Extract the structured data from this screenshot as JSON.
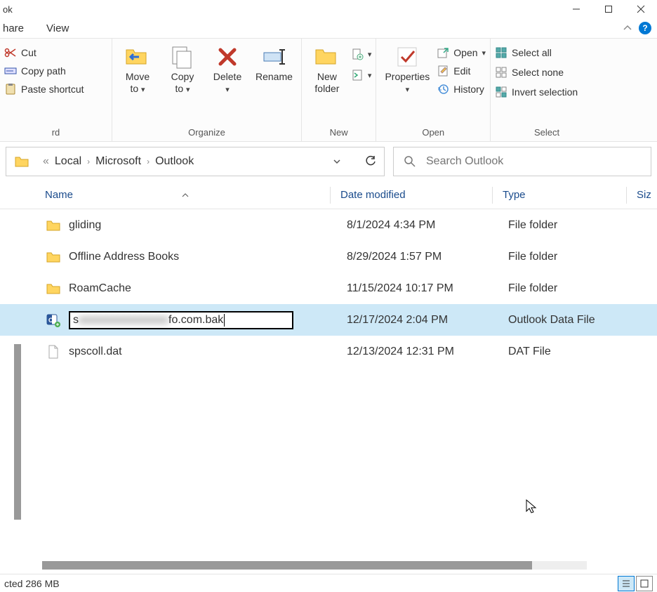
{
  "title_suffix": "ok",
  "tabs": {
    "share": "hare",
    "view": "View"
  },
  "clipboard": {
    "cut": "Cut",
    "copy_path": "Copy path",
    "paste_shortcut": "Paste shortcut",
    "group": "rd"
  },
  "organize": {
    "move_to": "Move\nto",
    "copy_to": "Copy\nto",
    "delete": "Delete",
    "rename": "Rename",
    "group": "Organize"
  },
  "new": {
    "new_folder": "New\nfolder",
    "group": "New"
  },
  "open": {
    "properties": "Properties",
    "open": "Open",
    "edit": "Edit",
    "history": "History",
    "group": "Open"
  },
  "select": {
    "select_all": "Select all",
    "select_none": "Select none",
    "invert_selection": "Invert selection",
    "group": "Select"
  },
  "breadcrumb": {
    "prefix": "«",
    "p1": "Local",
    "p2": "Microsoft",
    "p3": "Outlook"
  },
  "search": {
    "placeholder": "Search Outlook"
  },
  "columns": {
    "name": "Name",
    "date": "Date modified",
    "type": "Type",
    "size": "Siz"
  },
  "files": [
    {
      "icon": "folder",
      "name": "gliding",
      "date": "8/1/2024 4:34 PM",
      "type": "File folder"
    },
    {
      "icon": "folder",
      "name": "Offline Address Books",
      "date": "8/29/2024 1:57 PM",
      "type": "File folder"
    },
    {
      "icon": "folder",
      "name": "RoamCache",
      "date": "11/15/2024 10:17 PM",
      "type": "File folder"
    },
    {
      "icon": "ost",
      "name_pre": "s",
      "name_blur": "xxxxxxxxxxxxxxxx",
      "name_post": "fo.com.bak",
      "date": "12/17/2024 2:04 PM",
      "type": "Outlook Data File",
      "selected": true,
      "rename": true
    },
    {
      "icon": "file",
      "name": "spscoll.dat",
      "date": "12/13/2024 12:31 PM",
      "type": "DAT File"
    }
  ],
  "status": {
    "selected": "cted  286 MB"
  }
}
